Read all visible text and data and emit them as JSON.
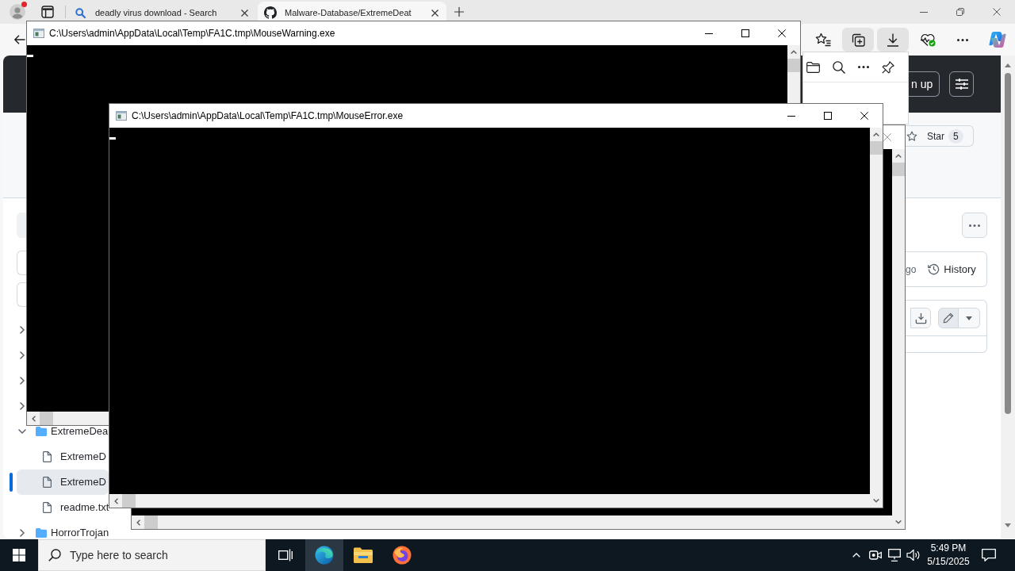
{
  "browser": {
    "profile": {
      "notification": true
    },
    "tabs": [
      {
        "kind": "search",
        "title": "deadly virus download - Search",
        "selected": false
      },
      {
        "kind": "github",
        "title": "Malware-Database/ExtremeDeat",
        "selected": true
      }
    ],
    "toolbar": [
      {
        "kind": "favorites",
        "selected": false
      },
      {
        "kind": "collections",
        "selected": true
      },
      {
        "kind": "downloads",
        "selected": true
      },
      {
        "kind": "essentials",
        "selected": false
      },
      {
        "kind": "more",
        "selected": false
      },
      {
        "kind": "copilot",
        "selected": false
      }
    ],
    "downloads_panel": {
      "tools": [
        {
          "kind": "folder"
        },
        {
          "kind": "search"
        },
        {
          "kind": "more"
        },
        {
          "kind": "pin"
        }
      ]
    },
    "page": {
      "header": {
        "buttons": [
          {
            "kind": "outline",
            "label": "n up"
          },
          {
            "kind": "filter"
          }
        ]
      },
      "repo": {
        "star": {
          "label": "Star",
          "count": "5"
        }
      },
      "sidebar": {
        "controls": [
          {
            "kind": "button"
          },
          {
            "kind": "field"
          },
          {
            "kind": "field"
          }
        ],
        "tree": [
          {
            "kind": "folder",
            "expanded": false,
            "selected": false
          },
          {
            "kind": "folder",
            "expanded": false,
            "selected": false
          },
          {
            "kind": "folder",
            "expanded": false,
            "selected": false
          },
          {
            "kind": "folder",
            "expanded": false,
            "selected": false
          },
          {
            "kind": "folder",
            "name": "ExtremeDea",
            "expanded": true,
            "selected": false,
            "children": [
              {
                "kind": "file",
                "name": "ExtremeD",
                "selected": false
              },
              {
                "kind": "file",
                "name": "ExtremeD",
                "selected": true
              },
              {
                "kind": "file",
                "name": "readme.txt",
                "selected": false
              }
            ]
          },
          {
            "kind": "folder",
            "name": "HorrorTrojan",
            "expanded": false,
            "selected": false
          }
        ]
      },
      "file": {
        "commit_time": "go",
        "history": "History",
        "actions": [
          {
            "kind": "download",
            "selected": false
          },
          {
            "kind": "edit",
            "selected": true
          },
          {
            "kind": "dropdown",
            "selected": false
          }
        ]
      }
    }
  },
  "windows": [
    {
      "kind": "console",
      "title": "C:\\Users\\admin\\AppData\\Local\\Temp\\FA1C.tmp\\MouseWarning.exe",
      "cursor": true
    },
    {
      "kind": "console"
    },
    {
      "kind": "console",
      "title": "C:\\Users\\admin\\AppData\\Local\\Temp\\FA1C.tmp\\MouseError.exe",
      "cursor": true
    }
  ],
  "taskbar": {
    "search": {
      "placeholder": "Type here to search"
    },
    "apps": [
      {
        "kind": "task_view",
        "selected": false
      },
      {
        "kind": "edge",
        "selected": true
      },
      {
        "kind": "explorer",
        "selected": false
      },
      {
        "kind": "firefox",
        "selected": false
      }
    ],
    "tray": {
      "time": "5:49 PM",
      "date": "5/15/2025"
    }
  }
}
